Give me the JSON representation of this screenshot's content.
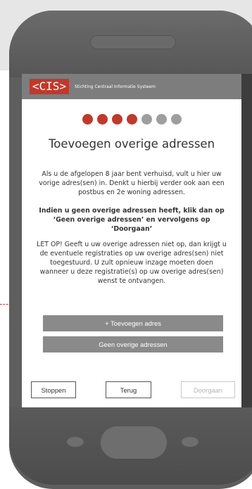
{
  "header": {
    "logo_text": "<CIS>",
    "org_name": "Stichting Centraal Informatie Systeem"
  },
  "progress": {
    "total_steps": 7,
    "completed_steps": 4
  },
  "page": {
    "title": "Toevoegen overige adressen",
    "intro": "Als u de afgelopen 8 jaar bent verhuisd, vult u hier uw vorige adres(sen) in. Denkt u hierbij verder ook aan een postbus en 2e woning adressen.",
    "instruction": "Indien u geen overige adressen heeft, klik dan op ‘Geen overige adressen’ en vervolgens op ‘Doorgaan’",
    "warning": "LET OP! Geeft u uw overige adressen niet op, dan krijgt u de eventuele registraties op uw overige adres(sen) niet toegestuurd. U zult opnieuw inzage moeten doen wanneer u deze registratie(s) op uw overige adres(sen) wenst te ontvangen."
  },
  "actions": {
    "add_address": "+ Toevoegen adres",
    "no_other_addresses": "Geen overige adressen"
  },
  "navigation": {
    "stop": "Stoppen",
    "back": "Terug",
    "continue": "Doorgaan"
  },
  "colors": {
    "accent": "#c0392b",
    "header_bg": "#7d7d7d",
    "button_bg": "#8a8a8a",
    "phone_body": "#5e5e5e",
    "inactive_dot": "#9e9e9e"
  }
}
